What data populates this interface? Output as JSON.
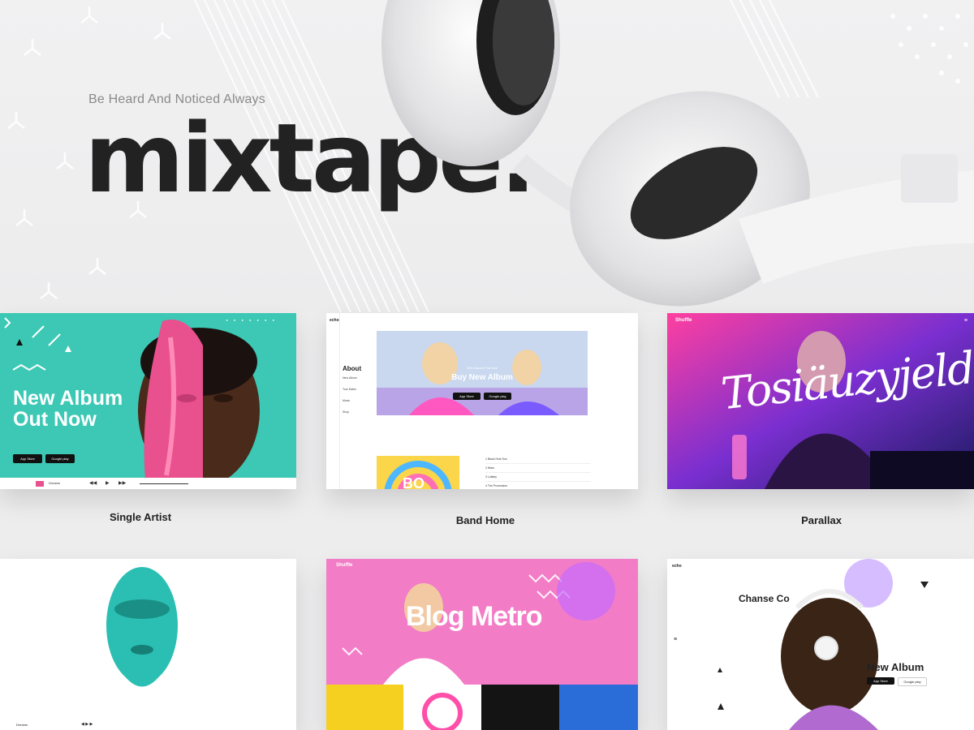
{
  "hero": {
    "tagline": "Be Heard And Noticed Always",
    "logo": "mixtape.",
    "colors": {
      "background": "#ededee",
      "logo": "#222222",
      "tagline": "#8a8a8a"
    }
  },
  "cards": [
    {
      "label": "Single Artist",
      "headline_line1": "New Album",
      "headline_line2": "Out Now",
      "store_buttons": [
        "App Store",
        "Google play"
      ],
      "player_track": "Dreams",
      "accent": "#3cc8b4"
    },
    {
      "label": "Band Home",
      "logo": "echo",
      "menu_title": "About",
      "menu_items": [
        "New Album",
        "Tour Dates",
        "Music",
        "Shop"
      ],
      "discount_text": "30% Discount This June",
      "headline": "Buy New Album",
      "store_buttons": [
        "App Store",
        "Google play"
      ],
      "album_art_text": "BO",
      "tracks": [
        "1 Black Hole Sun",
        "2 Wars",
        "3 Lullaby",
        "4 The Procession"
      ]
    },
    {
      "label": "Parallax",
      "brand": "Shuffle",
      "script_title": "Tosiäuzyjeld"
    },
    {
      "label": "",
      "player_track": "Dreams"
    },
    {
      "label": "",
      "brand": "Shuffle",
      "headline": "Blog Metro"
    },
    {
      "label": "",
      "logo": "echo",
      "artist": "Chanse Co",
      "headline": "New Album",
      "store_buttons": [
        "App Store",
        "Google play"
      ]
    }
  ]
}
